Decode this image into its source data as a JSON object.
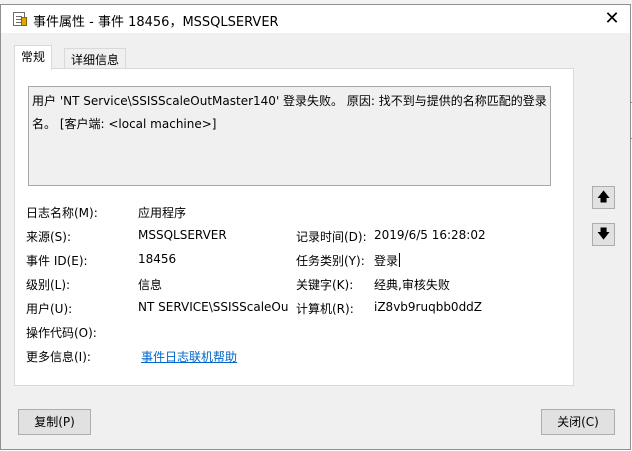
{
  "window": {
    "title": "事件属性 - 事件 18456，MSSQLSERVER",
    "close_glyph": "✕"
  },
  "tabs": [
    {
      "label": "常规"
    },
    {
      "label": "详细信息"
    }
  ],
  "description": "用户 'NT Service\\SSISScaleOutMaster140' 登录失败。 原因: 找不到与提供的名称匹配的登录名。 [客户端: <local machine>]",
  "fields": {
    "log_name_label": "日志名称(M):",
    "log_name": "应用程序",
    "source_label": "来源(S):",
    "source": "MSSQLSERVER",
    "logged_label": "记录时间(D):",
    "logged": "2019/6/5 16:28:02",
    "event_id_label": "事件 ID(E):",
    "event_id": "18456",
    "task_category_label": "任务类别(Y):",
    "task_category": "登录",
    "level_label": "级别(L):",
    "level": "信息",
    "keywords_label": "关键字(K):",
    "keywords": "经典,审核失败",
    "user_label": "用户(U):",
    "user": "NT SERVICE\\SSISScaleOut",
    "computer_label": "计算机(R):",
    "computer": "iZ8vb9ruqbb0ddZ",
    "opcode_label": "操作代码(O):",
    "opcode": "",
    "more_info_label": "更多信息(I):",
    "more_info_link": "事件日志联机帮助"
  },
  "nav": {
    "up_glyph": "🡅",
    "down_glyph": "🡇"
  },
  "buttons": {
    "copy": "复制(P)",
    "close": "关闭(C)"
  }
}
